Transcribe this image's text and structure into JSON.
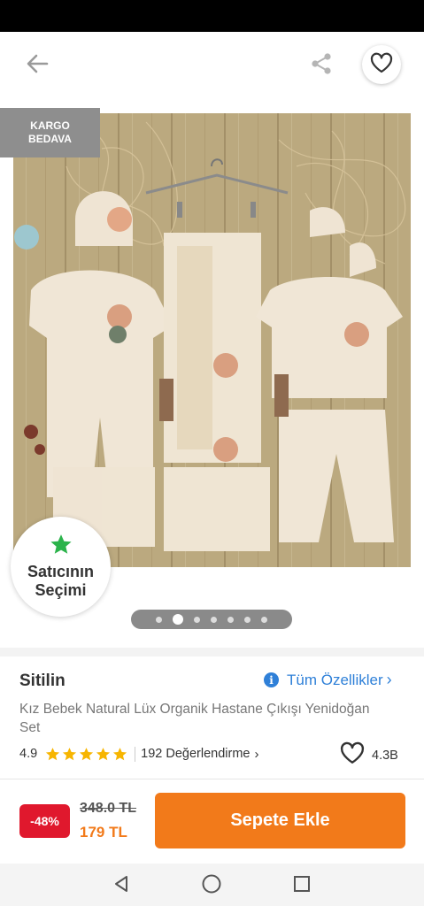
{
  "header": {
    "back_icon": "arrow-left-icon",
    "share_icon": "share-icon",
    "favorite_icon": "heart-outline-icon"
  },
  "gallery": {
    "badge_line1": "KARGO",
    "badge_line2": "BEDAVA",
    "seller_choice_line1": "Satıcının",
    "seller_choice_line2": "Seçimi",
    "seller_choice_icon": "star-icon",
    "page_count": 7,
    "active_page": 2
  },
  "product": {
    "brand": "Sitilin",
    "all_features_label": "Tüm Özellikler",
    "all_features_chevron": "›",
    "info_icon_glyph": "i",
    "name": "Kız Bebek Natural Lüx Organik Hastane Çıkışı Yenidoğan Set",
    "rating": "4.9",
    "star_count": 5,
    "reviews_label": "192 Değerlendirme",
    "reviews_chevron": "›",
    "favorites_count": "4.3B"
  },
  "cart": {
    "discount": "-48%",
    "old_price": "348.0 TL",
    "new_price": "179 TL",
    "add_to_cart_label": "Sepete Ekle"
  },
  "system_nav": {
    "back": "triangle-back-icon",
    "home": "circle-home-icon",
    "recents": "square-recents-icon"
  },
  "colors": {
    "accent": "#f27a1a",
    "discount_red": "#e0182d",
    "link_blue": "#2f80d8",
    "star_orange": "#f7b500",
    "badge_green": "#2bb34b"
  }
}
